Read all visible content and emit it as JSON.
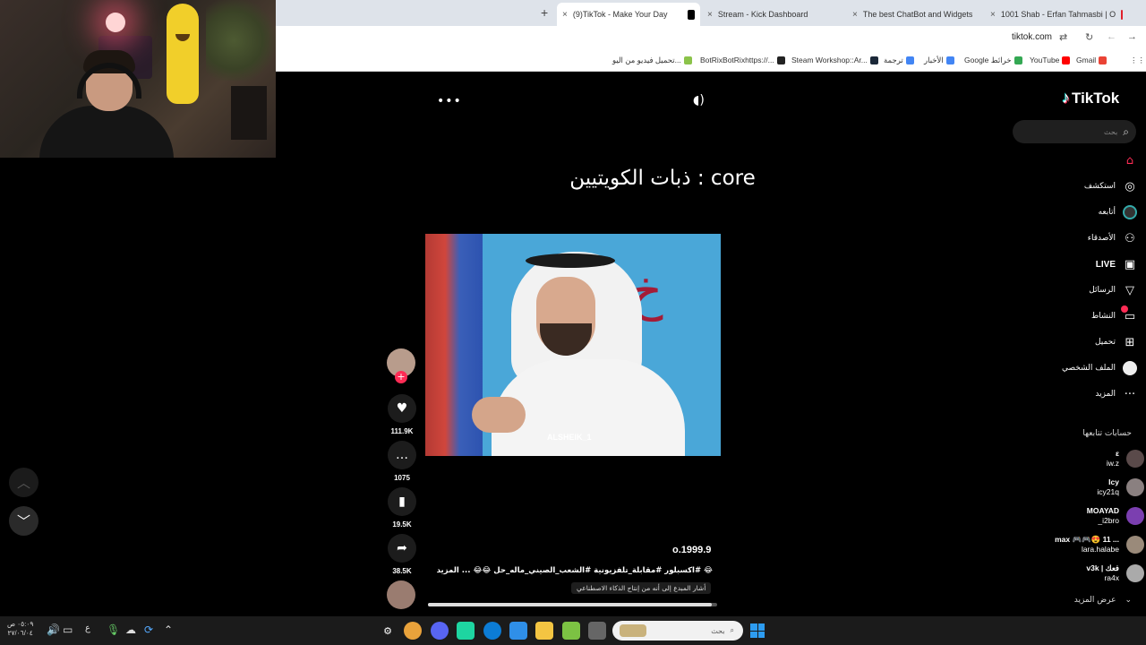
{
  "browser": {
    "tabs": [
      {
        "title": "(9)TikTok - Make Your Day",
        "active": true,
        "favicon_color": "#000000"
      },
      {
        "title": "Stream - Kick Dashboard",
        "favicon_color": "#53fc18"
      },
      {
        "title": "The best ChatBot and Widgets",
        "favicon_color": "#333333"
      },
      {
        "title": "1001 Shab - Erfan Tahmasbi | O",
        "favicon_color": "#e0202b"
      }
    ],
    "new_tab": "+",
    "close": "×",
    "url": "tiktok.com",
    "bookmarks": [
      {
        "label": "Gmail",
        "color": "#ea4335"
      },
      {
        "label": "YouTube",
        "color": "#ff0000"
      },
      {
        "label": "Google خرائط",
        "color": "#34a853"
      },
      {
        "label": "الأخبار",
        "color": "#4285f4"
      },
      {
        "label": "ترجمة",
        "color": "#4285f4"
      },
      {
        "label": "Steam Workshop::Ar...",
        "color": "#1b2838"
      },
      {
        "label": "BotRixBotRixhttps://...",
        "color": "#222222"
      },
      {
        "label": "تحميل فيديو من اليو...",
        "color": "#8bc34a"
      }
    ]
  },
  "tiktok": {
    "logo_text": "TikTok",
    "search_placeholder": "بحث",
    "menu": [
      {
        "label": "",
        "icon": "home-icon",
        "glyph": "⌂"
      },
      {
        "label": "استكشف",
        "icon": "compass-icon",
        "glyph": "◎"
      },
      {
        "label": "أتابعه",
        "icon": "following-avatar-icon",
        "glyph": "●"
      },
      {
        "label": "الأصدقاء",
        "icon": "friends-icon",
        "glyph": "👥"
      },
      {
        "label": "LIVE",
        "icon": "live-icon",
        "glyph": "▣"
      },
      {
        "label": "الرسائل",
        "icon": "messages-icon",
        "glyph": "➢"
      },
      {
        "label": "النشاط",
        "icon": "activity-icon",
        "glyph": "▭"
      },
      {
        "label": "تحميل",
        "icon": "upload-icon",
        "glyph": "⊞"
      },
      {
        "label": "الملف الشخصي",
        "icon": "profile-avatar-icon",
        "glyph": "●"
      },
      {
        "label": "المزيد",
        "icon": "more-icon",
        "glyph": "···"
      }
    ],
    "following_title": "حسابات تتابعها",
    "following": [
      {
        "name": "ε",
        "handle": "iw.z"
      },
      {
        "name": "Icy",
        "handle": "icy21q"
      },
      {
        "name": "MOAYAD",
        "handle": "_i2bro"
      },
      {
        "name": "max 🎮🎮😍 11 ...",
        "handle": "lara.halabe"
      },
      {
        "name": "v3k | فعك",
        "handle": "ra4x"
      }
    ],
    "see_more": "عرض المزيد",
    "video": {
      "overlay_caption": "ذبات الكويتيين : core",
      "watermark": "ALSHEIK_1",
      "username": "o.1999.9",
      "description": "😂 #اكسبلور #مقابلة_تلفزيونية #الشعب_الصيني_ماله_حل 😂😂 ...",
      "more_label": "المزيد",
      "ai_label": "أشار المبدع إلى أنه من إنتاج الذكاء الاصطناعي",
      "progress": 0.98,
      "stats": {
        "likes": "111.9K",
        "comments": "1075",
        "saves": "19.5K",
        "shares": "38.5K"
      }
    }
  },
  "taskbar": {
    "time": "٠٥:٠٩ ص",
    "date": "٢٧/٠٦/٠٤",
    "lang": "ع",
    "search_placeholder": "بحث"
  }
}
